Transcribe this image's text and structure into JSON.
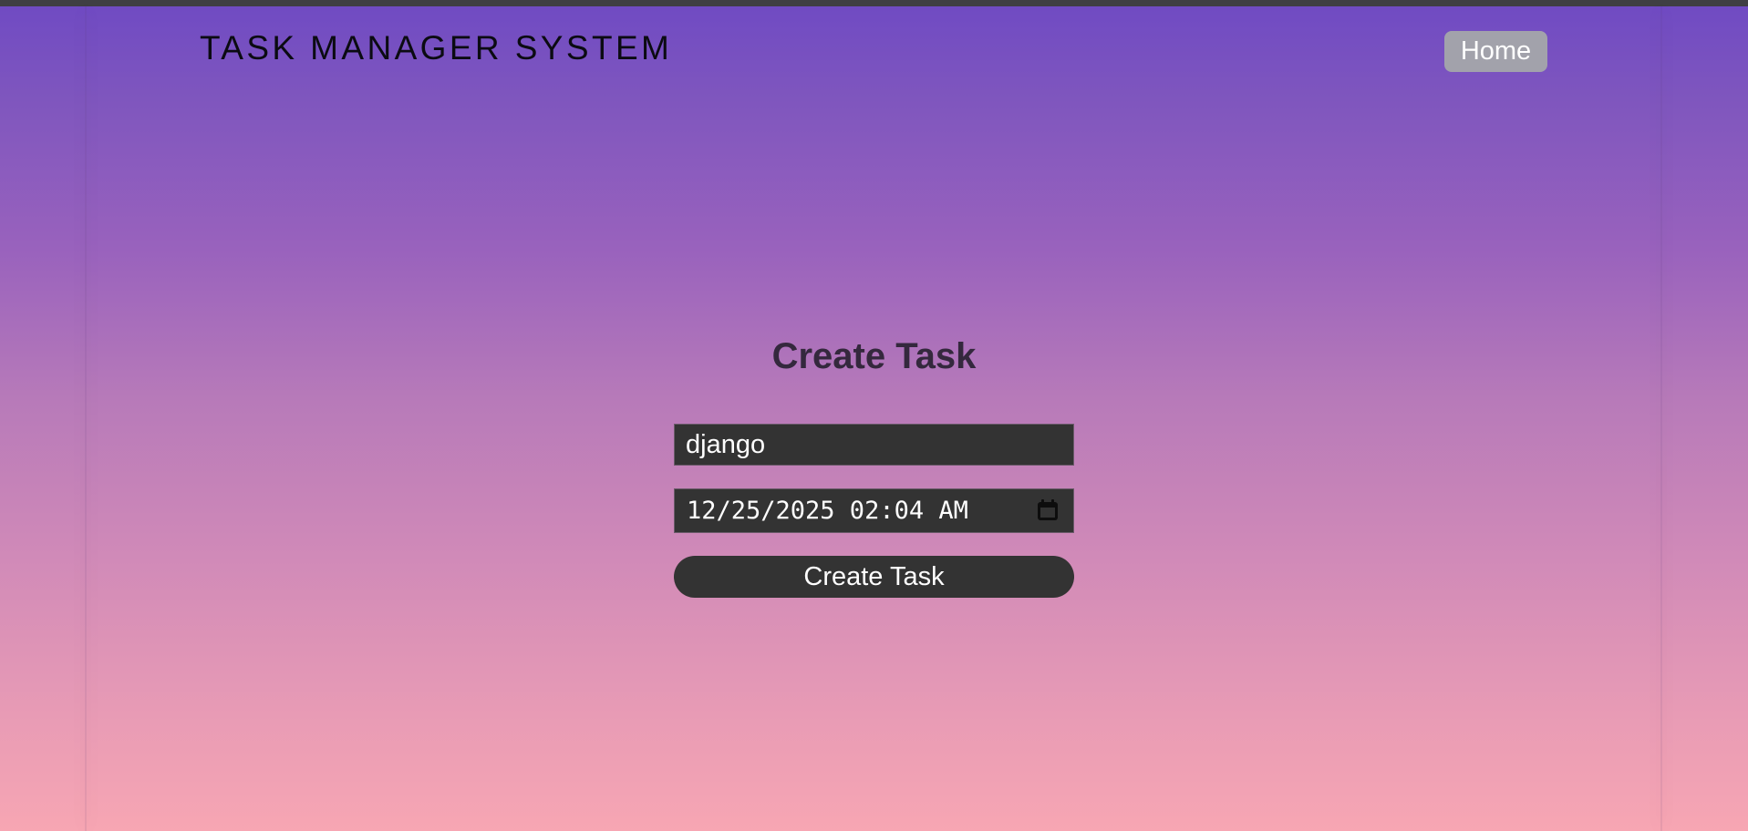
{
  "header": {
    "site_title": "TASK MANAGER SYSTEM",
    "home_label": "Home"
  },
  "form": {
    "heading": "Create Task",
    "task_name_value": "django",
    "due_datetime_value": "12/25/2025 02:04 AM",
    "submit_label": "Create Task"
  },
  "icons": {
    "calendar": "calendar-icon"
  },
  "colors": {
    "gradient_top": "#6f4ac3",
    "gradient_bottom": "#f7a6b3",
    "field_background": "#333333",
    "home_button": "#a2a2ab",
    "heading": "#34283d"
  }
}
